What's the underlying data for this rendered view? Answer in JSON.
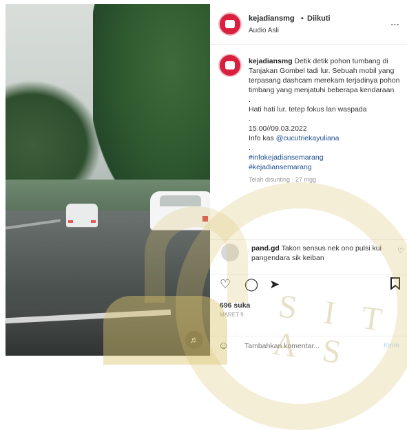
{
  "header": {
    "username": "kejadiansmg",
    "separator": "•",
    "follow_label": "Diikuti",
    "audio_label": "Audio Asli",
    "more_icon": "more-horizontal-icon"
  },
  "caption": {
    "username": "kejadiansmg",
    "text": "Detik detik pohon tumbang di Tanjakan Gombel tadi lur. Sebuah mobil yang terpasang dashcam merekam terjadinya pohon timbang yang menjatuhi beberapa kendaraan",
    "dot1": ".",
    "line2": "Hati hati lur. tetep fokus lan waspada",
    "dot2": ".",
    "datetime": "15.00//09.03.2022",
    "info_prefix": "Info kas ",
    "mention": "@cucutriekayuliana",
    "dot3": ".",
    "hashtag1": "#infokejadiansemarang",
    "hashtag2": "#kejadiansemarang",
    "time_ago": "Telah disunting · 27 mgg"
  },
  "comment": {
    "username": "pand.gd",
    "text": "Takon sensus nek ono pulsi kui pangendara sik keiban"
  },
  "actions": {
    "like_icon": "heart-icon",
    "comment_icon": "comment-icon",
    "share_icon": "send-icon",
    "save_icon": "bookmark-icon",
    "likes": "696 suka",
    "date": "MARET 9"
  },
  "add_comment": {
    "placeholder": "Tambahkan komentar...",
    "post_label": "Kirim",
    "emoji_icon": "emoji-icon"
  },
  "video": {
    "mute_icon": "volume-icon"
  },
  "watermark": {
    "text": "S I T A S"
  },
  "colors": {
    "avatar": "#d7213e",
    "link": "#1e4f8c",
    "post_button": "#b3d4ee"
  }
}
